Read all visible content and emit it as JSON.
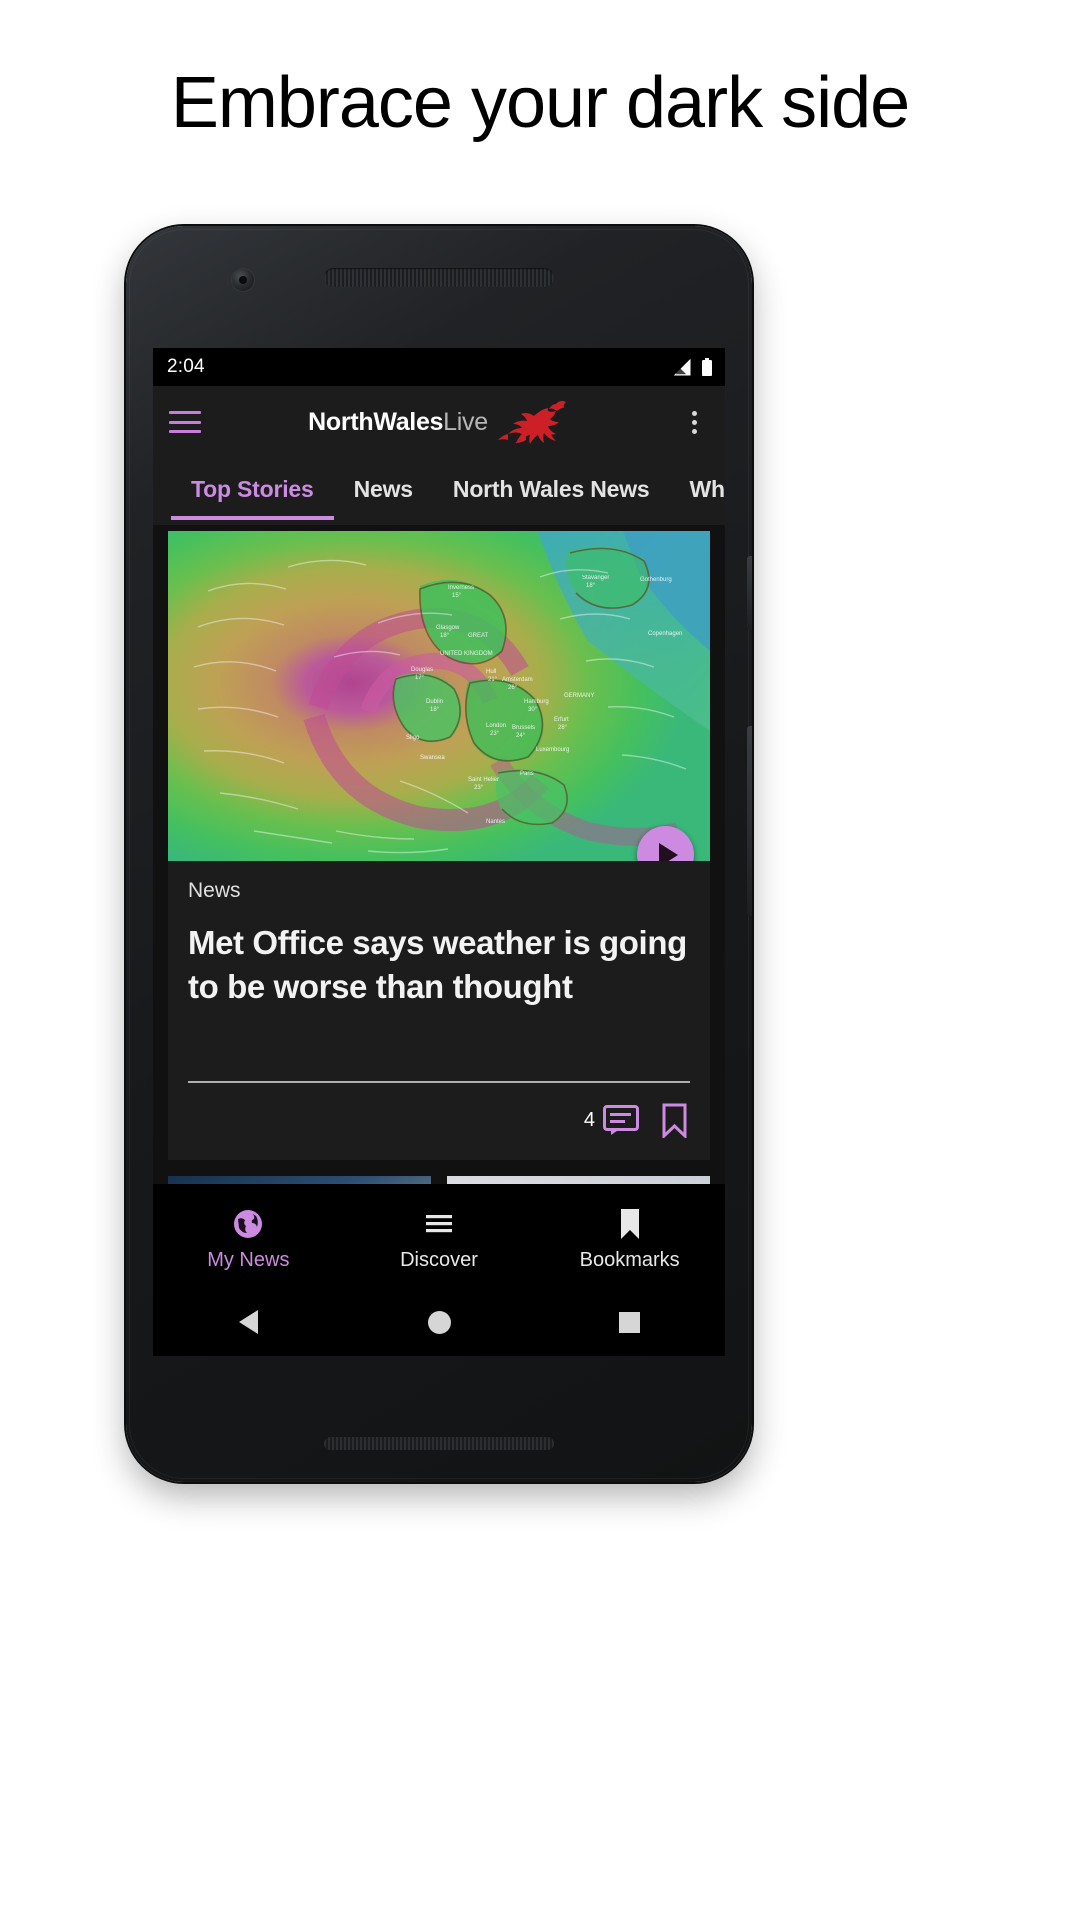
{
  "promo": {
    "headline": "Embrace your dark side"
  },
  "phone": {
    "status_bar": {
      "time": "2:04",
      "icons": [
        "signal-icon",
        "battery-icon"
      ]
    },
    "app_bar": {
      "menu_icon": "hamburger-menu-icon",
      "brand_primary": "NorthWales",
      "brand_secondary": "Live",
      "brand_logo_icon": "welsh-dragon-icon",
      "overflow_icon": "kebab-menu-icon"
    },
    "tabs": [
      {
        "label": "Top Stories",
        "active": true
      },
      {
        "label": "News",
        "active": false
      },
      {
        "label": "North Wales News",
        "active": false
      },
      {
        "label": "What's On",
        "active": false
      }
    ],
    "feed": {
      "card": {
        "media_icon": "weather-map-image",
        "play_icon": "play-button-icon",
        "kicker": "News",
        "title": "Met Office says weather is going to be worse than thought",
        "comment_count": "4",
        "comment_icon": "comment-icon",
        "bookmark_icon": "bookmark-icon"
      }
    },
    "bottom_nav": [
      {
        "label": "My News",
        "icon": "globe-icon",
        "active": true
      },
      {
        "label": "Discover",
        "icon": "list-icon",
        "active": false
      },
      {
        "label": "Bookmarks",
        "icon": "bookmark-icon",
        "active": false
      }
    ],
    "system_nav": [
      {
        "name": "back",
        "icon": "triangle-back-icon"
      },
      {
        "name": "home",
        "icon": "circle-home-icon"
      },
      {
        "name": "recents",
        "icon": "square-recents-icon"
      }
    ]
  },
  "colors": {
    "accent": "#cc8ae0",
    "screen_bg": "#111111",
    "surface": "#1c1c1c",
    "brand_red": "#cc2026"
  }
}
